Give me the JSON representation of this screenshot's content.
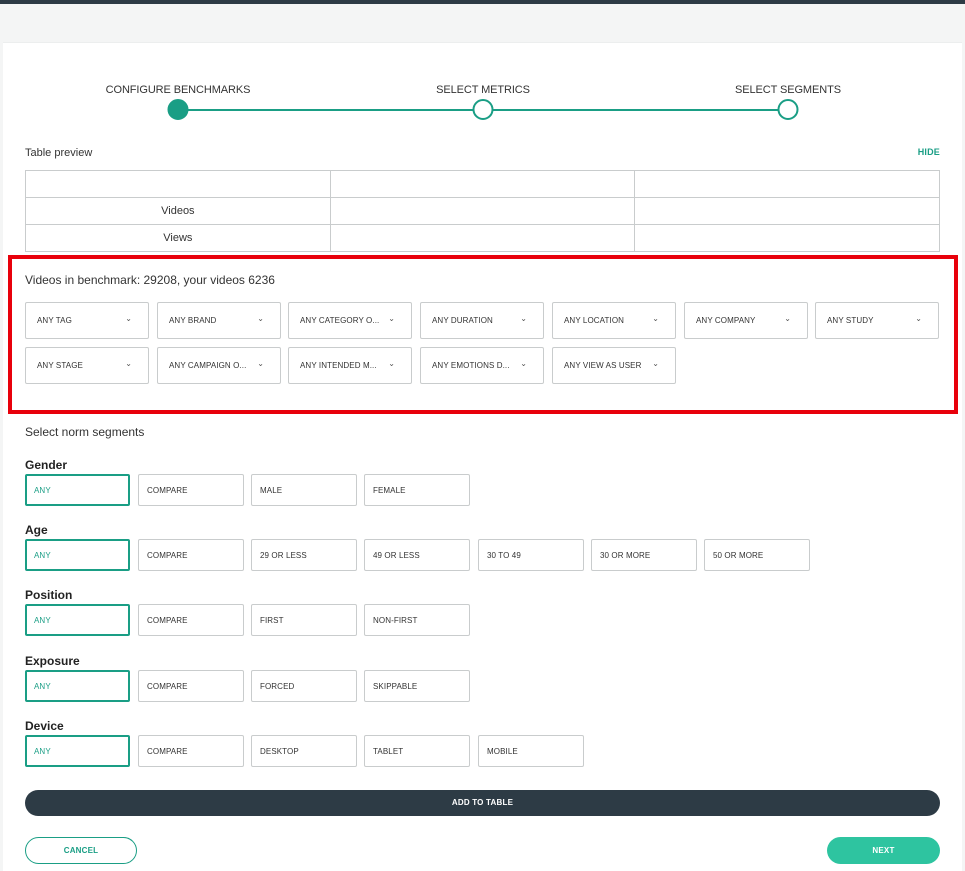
{
  "stepper": {
    "steps": [
      {
        "label": "CONFIGURE BENCHMARKS",
        "state": "done"
      },
      {
        "label": "SELECT METRICS",
        "state": "todo"
      },
      {
        "label": "SELECT SEGMENTS",
        "state": "todo"
      }
    ]
  },
  "preview": {
    "title": "Table preview",
    "hide_label": "HIDE",
    "rows": [
      [
        "",
        "",
        ""
      ],
      [
        "Videos",
        "",
        ""
      ],
      [
        "Views",
        "",
        ""
      ]
    ]
  },
  "benchmark": {
    "title": "Videos in benchmark: 29208, your videos 6236",
    "filters": [
      "ANY TAG",
      "ANY BRAND",
      "ANY CATEGORY O...",
      "ANY DURATION",
      "ANY LOCATION",
      "ANY COMPANY",
      "ANY STUDY",
      "ANY STAGE",
      "ANY CAMPAIGN O...",
      "ANY INTENDED M...",
      "ANY EMOTIONS D...",
      "ANY VIEW AS USER"
    ],
    "chevron_icon": "chevron-down-icon"
  },
  "norm": {
    "title": "Select norm segments",
    "segments": [
      {
        "label": "Gender",
        "options": [
          "ANY",
          "COMPARE",
          "MALE",
          "FEMALE"
        ],
        "selected": 0
      },
      {
        "label": "Age",
        "options": [
          "ANY",
          "COMPARE",
          "29 OR LESS",
          "49 OR LESS",
          "30 TO 49",
          "30 OR MORE",
          "50 OR MORE"
        ],
        "selected": 0
      },
      {
        "label": "Position",
        "options": [
          "ANY",
          "COMPARE",
          "FIRST",
          "NON-FIRST"
        ],
        "selected": 0
      },
      {
        "label": "Exposure",
        "options": [
          "ANY",
          "COMPARE",
          "FORCED",
          "SKIPPABLE"
        ],
        "selected": 0
      },
      {
        "label": "Device",
        "options": [
          "ANY",
          "COMPARE",
          "DESKTOP",
          "TABLET",
          "MOBILE"
        ],
        "selected": 0
      }
    ]
  },
  "actions": {
    "add_label": "ADD TO TABLE",
    "cancel_label": "CANCEL",
    "next_label": "NEXT"
  },
  "colors": {
    "accent": "#1a9e85",
    "next": "#2ec4a0",
    "dark": "#2d3b45",
    "highlight": "#e8000b"
  }
}
